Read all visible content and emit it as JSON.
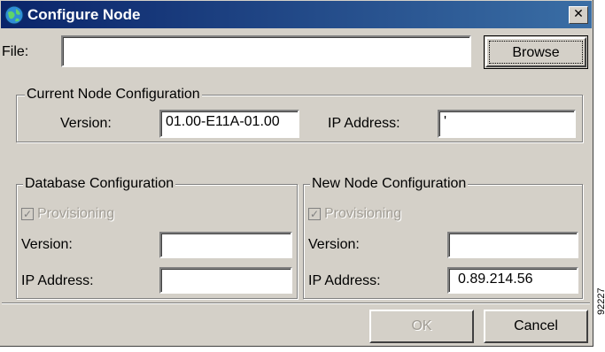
{
  "window": {
    "title": "Configure Node",
    "close_glyph": "✕"
  },
  "file": {
    "label": "File:",
    "value": "",
    "browse_label": "Browse"
  },
  "current": {
    "title": "Current Node Configuration",
    "version_label": "Version:",
    "version_value": "01.00-E11A-01.00",
    "ip_label": "IP Address:",
    "ip_value": "'"
  },
  "database": {
    "title": "Database Configuration",
    "provisioning_label": "Provisioning",
    "provisioning_checked": true,
    "version_label": "Version:",
    "version_value": "",
    "ip_label": "IP Address:",
    "ip_value": ""
  },
  "new_node": {
    "title": "New Node Configuration",
    "provisioning_label": "Provisioning",
    "provisioning_checked": true,
    "version_label": "Version:",
    "version_value": "",
    "ip_label": "IP Address:",
    "ip_value": "0.89.214.56"
  },
  "buttons": {
    "ok_label": "OK",
    "cancel_label": "Cancel"
  },
  "side_text": "92227",
  "icons": {
    "app": "globe-icon",
    "check": "✓"
  },
  "colors": {
    "title_start": "#0a246a",
    "title_end": "#3a6ea5",
    "face": "#d4d0c8"
  }
}
